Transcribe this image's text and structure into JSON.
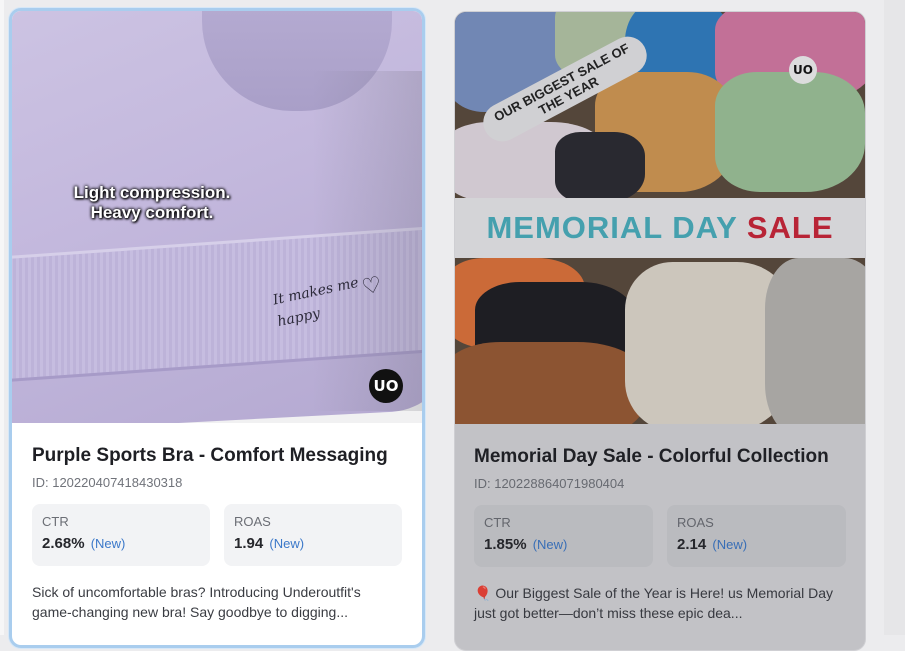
{
  "cards": [
    {
      "image_overlay_lines": [
        "Light compression.",
        "Heavy comfort."
      ],
      "image_script": "It makes me happy",
      "logo": "UO",
      "title": "Purple Sports Bra - Comfort Messaging",
      "id_text": "ID: 120220407418430318",
      "metrics": [
        {
          "label": "CTR",
          "value": "2.68%",
          "badge": "(New)"
        },
        {
          "label": "ROAS",
          "value": "1.94",
          "badge": "(New)"
        }
      ],
      "description": "Sick of uncomfortable bras? Introducing Underoutfit's game-changing new bra! Say goodbye to digging..."
    },
    {
      "image_tag": "OUR BIGGEST SALE OF THE YEAR",
      "image_banner": {
        "part1": "MEMORIAL DAY",
        "part2": "SALE"
      },
      "logo": "UO",
      "title": "Memorial Day Sale - Colorful Collection",
      "id_text": "ID: 120228864071980404",
      "metrics": [
        {
          "label": "CTR",
          "value": "1.85%",
          "badge": "(New)"
        },
        {
          "label": "ROAS",
          "value": "2.14",
          "badge": "(New)"
        }
      ],
      "description": "🎈 Our Biggest Sale of the Year is Here! us Memorial Day just got better—don’t miss these epic dea..."
    }
  ],
  "colors": {
    "selected_border": "#a9cdee",
    "banner_teal": "#49b1c0",
    "banner_red": "#cc2437",
    "new_badge": "#3b78c9"
  }
}
